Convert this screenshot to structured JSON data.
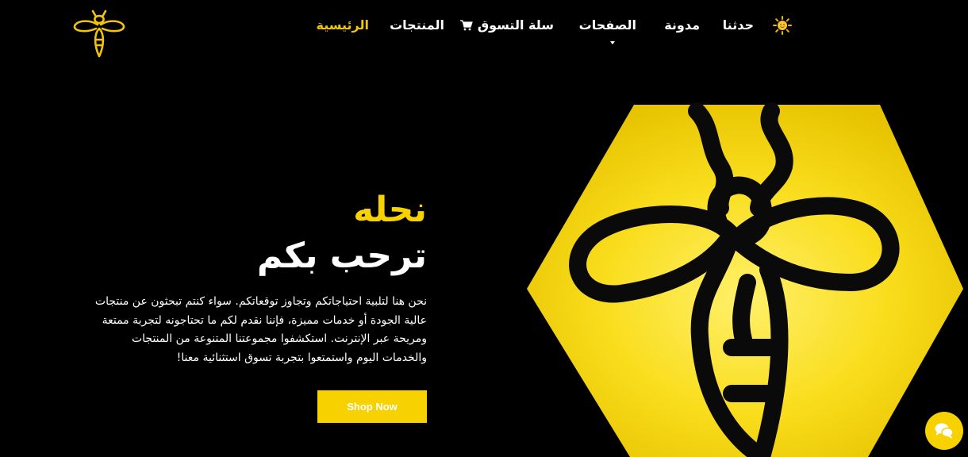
{
  "nav": {
    "home": "الرئيسية",
    "products": "المنتجات",
    "cart": "سلة التسوق",
    "pages": "الصفحات",
    "blog": "مدونة",
    "contact": "حدثنا"
  },
  "hero": {
    "title": "نحله",
    "subtitle": "ترحب بكم",
    "description": "نحن هنا لتلبية احتياجاتكم وتجاوز توقعاتكم. سواء كنتم تبحثون عن منتجات عالية الجودة أو خدمات مميزة، فإننا نقدم لكم ما تحتاجونه لتجربة ممتعة ومريحة عبر الإنترنت. استكشفوا مجموعتنا المتنوعة من المنتجات والخدمات اليوم واستمتعوا بتجربة تسوق استثنائية معنا!",
    "cta": "Shop Now"
  },
  "icons": {
    "logo": "bee-logo-icon",
    "cart": "cart-icon",
    "theme": "sun-icon",
    "chat": "chat-bubbles-icon",
    "dropdown": "caret-down-icon"
  },
  "colors": {
    "background": "#000000",
    "accent": "#f7d100",
    "text": "#ffffff"
  }
}
